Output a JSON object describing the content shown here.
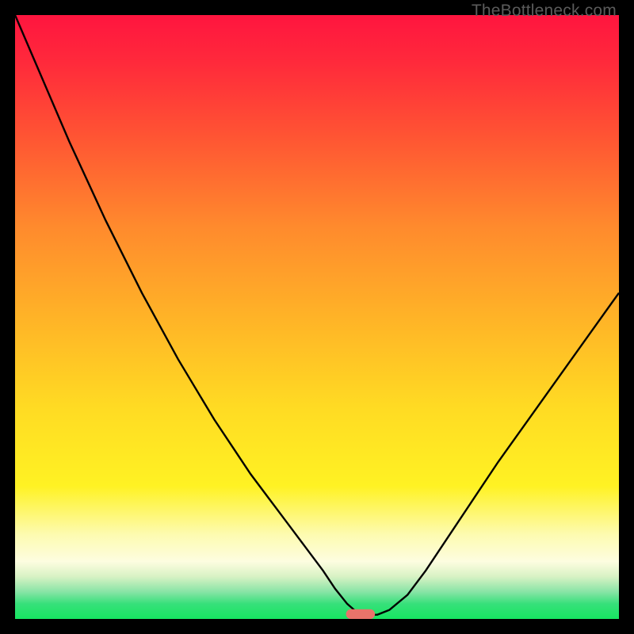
{
  "watermark": "TheBottleneck.com",
  "chart_data": {
    "type": "line",
    "title": "",
    "xlabel": "",
    "ylabel": "",
    "xlim": [
      0,
      100
    ],
    "ylim": [
      0,
      100
    ],
    "grid": false,
    "legend": false,
    "background": {
      "description": "vertical gradient from red at top through orange, yellow, pale-yellow, to green band at bottom",
      "stops": [
        {
          "pos": 0.0,
          "color": "#ff153f"
        },
        {
          "pos": 0.08,
          "color": "#ff2a3b"
        },
        {
          "pos": 0.2,
          "color": "#ff5433"
        },
        {
          "pos": 0.35,
          "color": "#ff8a2d"
        },
        {
          "pos": 0.5,
          "color": "#ffb327"
        },
        {
          "pos": 0.65,
          "color": "#ffdb23"
        },
        {
          "pos": 0.78,
          "color": "#fff223"
        },
        {
          "pos": 0.86,
          "color": "#fdfbb0"
        },
        {
          "pos": 0.905,
          "color": "#fdfde0"
        },
        {
          "pos": 0.93,
          "color": "#d8f2c4"
        },
        {
          "pos": 0.955,
          "color": "#88e4a6"
        },
        {
          "pos": 0.975,
          "color": "#37e07a"
        },
        {
          "pos": 1.0,
          "color": "#16e561"
        }
      ]
    },
    "series": [
      {
        "name": "bottleneck-curve",
        "color": "#000000",
        "width": 2.4,
        "x": [
          0,
          3,
          6,
          9,
          12,
          15,
          18,
          21,
          24,
          27,
          30,
          33,
          36,
          39,
          42,
          45,
          48,
          51,
          53,
          55,
          56.5,
          58,
          60,
          62,
          65,
          68,
          72,
          76,
          80,
          85,
          90,
          95,
          100
        ],
        "y": [
          100,
          93,
          86,
          79,
          72.5,
          66,
          60,
          54,
          48.5,
          43,
          38,
          33,
          28.5,
          24,
          20,
          16,
          12,
          8,
          5,
          2.5,
          1.2,
          0.7,
          0.7,
          1.5,
          4,
          8,
          14,
          20,
          26,
          33,
          40,
          47,
          54
        ]
      }
    ],
    "marker": {
      "name": "optimum-pill",
      "cx": 57.2,
      "cy": 0.8,
      "width": 4.8,
      "height": 1.6,
      "rx": 0.8,
      "color": "#e9736a"
    }
  }
}
